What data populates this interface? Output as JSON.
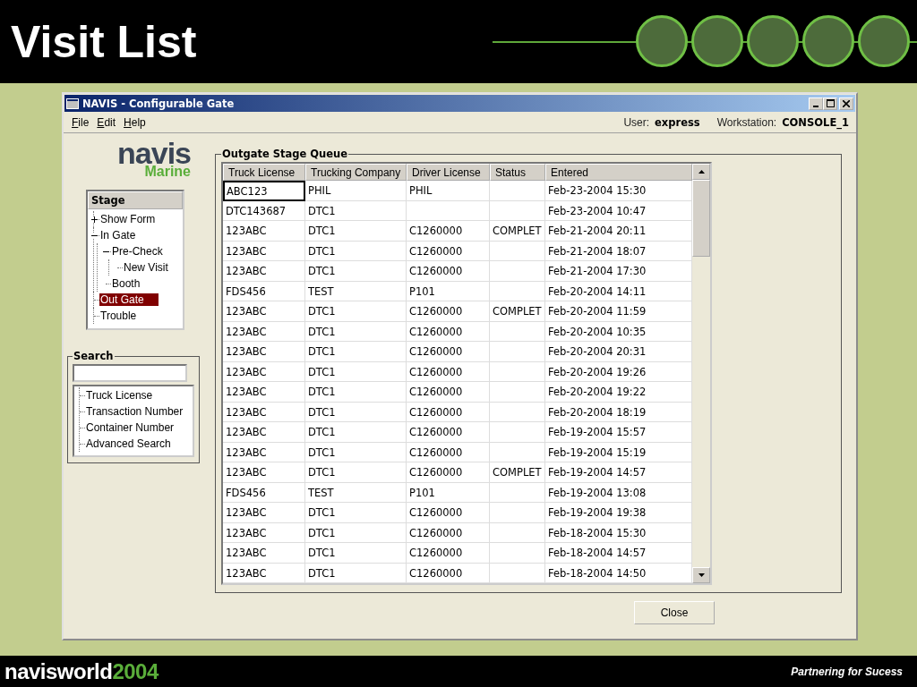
{
  "slide": {
    "title": "Visit List",
    "tagline": "Partnering for Sucess",
    "footer_logo": {
      "word": "navisworld",
      "year": "2004"
    }
  },
  "window": {
    "title": "NAVIS - Configurable Gate"
  },
  "menu": [
    {
      "label": "File"
    },
    {
      "label": "Edit"
    },
    {
      "label": "Help"
    }
  ],
  "user": {
    "label": "User:",
    "value": "express"
  },
  "workstation": {
    "label": "Workstation:",
    "value": "CONSOLE_1"
  },
  "logo": {
    "word": "navis",
    "sub": "Marine"
  },
  "stage": {
    "title": "Stage",
    "items": [
      {
        "label": "Show Form",
        "expanded": false,
        "selected": false
      },
      {
        "label": "In Gate",
        "expanded": true,
        "selected": false,
        "children": [
          {
            "label": "Pre-Check",
            "expanded": true,
            "selected": false,
            "children": [
              {
                "label": "New Visit",
                "selected": false
              }
            ]
          },
          {
            "label": "Booth",
            "selected": false
          }
        ]
      },
      {
        "label": "Out Gate",
        "selected": true
      },
      {
        "label": "Trouble",
        "selected": false
      }
    ]
  },
  "search": {
    "title": "Search",
    "options": [
      {
        "label": "Truck License"
      },
      {
        "label": "Transaction Number"
      },
      {
        "label": "Container Number"
      },
      {
        "label": "Advanced Search"
      }
    ]
  },
  "queue": {
    "title": "Outgate Stage Queue",
    "columns": [
      "Truck License",
      "Trucking Company",
      "Driver License",
      "Status",
      "Entered"
    ],
    "rows": [
      {
        "truck_license": "ABC123",
        "trucking_company": "PHIL",
        "driver_license": "PHIL",
        "entered": "Feb-23-2004 15:30",
        "focused": true
      },
      {
        "truck_license": "DTC143687",
        "trucking_company": "DTC1",
        "entered": "Feb-23-2004 10:47",
        "focused": false
      },
      {
        "truck_license": "123ABC",
        "trucking_company": "DTC1",
        "driver_license": "C1260000",
        "status": "COMPLET",
        "entered": "Feb-21-2004 20:11",
        "focused": false
      },
      {
        "truck_license": "123ABC",
        "trucking_company": "DTC1",
        "driver_license": "C1260000",
        "entered": "Feb-21-2004 18:07",
        "focused": false
      },
      {
        "truck_license": "123ABC",
        "trucking_company": "DTC1",
        "driver_license": "C1260000",
        "entered": "Feb-21-2004 17:30",
        "focused": false
      },
      {
        "truck_license": "FDS456",
        "trucking_company": "TEST",
        "driver_license": "P101",
        "entered": "Feb-20-2004 14:11",
        "focused": false
      },
      {
        "truck_license": "123ABC",
        "trucking_company": "DTC1",
        "driver_license": "C1260000",
        "status": "COMPLET",
        "entered": "Feb-20-2004 11:59",
        "focused": false
      },
      {
        "truck_license": "123ABC",
        "trucking_company": "DTC1",
        "driver_license": "C1260000",
        "entered": "Feb-20-2004 10:35",
        "focused": false
      },
      {
        "truck_license": "123ABC",
        "trucking_company": "DTC1",
        "driver_license": "C1260000",
        "entered": "Feb-20-2004 20:31",
        "focused": false
      },
      {
        "truck_license": "123ABC",
        "trucking_company": "DTC1",
        "driver_license": "C1260000",
        "entered": "Feb-20-2004 19:26",
        "focused": false
      },
      {
        "truck_license": "123ABC",
        "trucking_company": "DTC1",
        "driver_license": "C1260000",
        "entered": "Feb-20-2004 19:22",
        "focused": false
      },
      {
        "truck_license": "123ABC",
        "trucking_company": "DTC1",
        "driver_license": "C1260000",
        "entered": "Feb-20-2004 18:19",
        "focused": false
      },
      {
        "truck_license": "123ABC",
        "trucking_company": "DTC1",
        "driver_license": "C1260000",
        "entered": "Feb-19-2004 15:57",
        "focused": false
      },
      {
        "truck_license": "123ABC",
        "trucking_company": "DTC1",
        "driver_license": "C1260000",
        "entered": "Feb-19-2004 15:19",
        "focused": false
      },
      {
        "truck_license": "123ABC",
        "trucking_company": "DTC1",
        "driver_license": "C1260000",
        "status": "COMPLET",
        "entered": "Feb-19-2004 14:57",
        "focused": false
      },
      {
        "truck_license": "FDS456",
        "trucking_company": "TEST",
        "driver_license": "P101",
        "entered": "Feb-19-2004 13:08",
        "focused": false
      },
      {
        "truck_license": "123ABC",
        "trucking_company": "DTC1",
        "driver_license": "C1260000",
        "entered": "Feb-19-2004 19:38",
        "focused": false
      },
      {
        "truck_license": "123ABC",
        "trucking_company": "DTC1",
        "driver_license": "C1260000",
        "entered": "Feb-18-2004 15:30",
        "focused": false
      },
      {
        "truck_license": "123ABC",
        "trucking_company": "DTC1",
        "driver_license": "C1260000",
        "entered": "Feb-18-2004 14:57",
        "focused": false
      },
      {
        "truck_license": "123ABC",
        "trucking_company": "DTC1",
        "driver_license": "C1260000",
        "entered": "Feb-18-2004 14:50",
        "focused": false
      }
    ]
  },
  "close_button": "Close"
}
